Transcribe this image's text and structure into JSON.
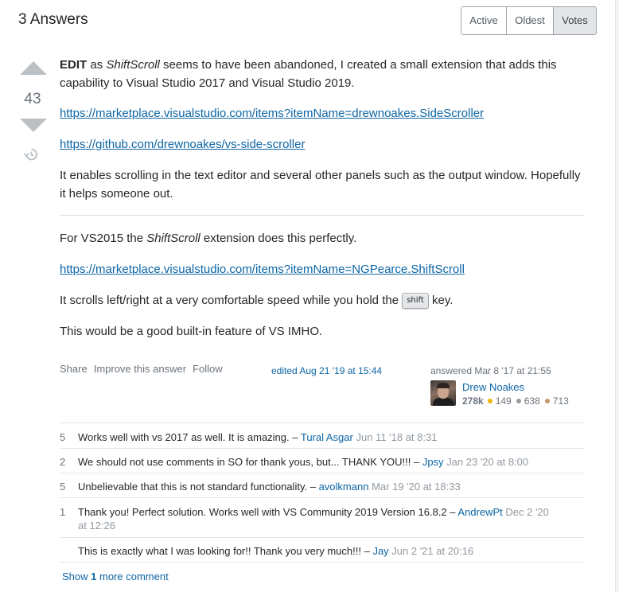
{
  "header": {
    "title": "3 Answers"
  },
  "sort_tabs": [
    {
      "label": "Active",
      "active": false
    },
    {
      "label": "Oldest",
      "active": false
    },
    {
      "label": "Votes",
      "active": true
    }
  ],
  "votes": {
    "count": "43",
    "up_icon": "arrow-up-icon",
    "down_icon": "arrow-down-icon",
    "history_icon": "history-icon"
  },
  "post": {
    "p1_bold": "EDIT",
    "p1_text1": " as ",
    "p1_italic": "ShiftScroll",
    "p1_text2": " seems to have been abandoned, I created a small extension that adds this capability to Visual Studio 2017 and Visual Studio 2019.",
    "link1": "https://marketplace.visualstudio.com/items?itemName=drewnoakes.SideScroller",
    "link2": "https://github.com/drewnoakes/vs-side-scroller",
    "p2": "It enables scrolling in the text editor and several other panels such as the output window. Hopefully it helps someone out.",
    "p3_text1": "For VS2015 the ",
    "p3_italic": "ShiftScroll",
    "p3_text2": " extension does this perfectly.",
    "link3": "https://marketplace.visualstudio.com/items?itemName=NGPearce.ShiftScroll",
    "p4_text1": "It scrolls left/right at a very comfortable speed while you hold the ",
    "p4_kbd": "shift",
    "p4_text2": " key.",
    "p5": "This would be a good built-in feature of VS IMHO."
  },
  "menu": {
    "share": "Share",
    "improve": "Improve this answer",
    "follow": "Follow"
  },
  "edited": "edited Aug 21 '19 at 15:44",
  "answered": "answered Mar 8 '17 at 21:55",
  "user": {
    "name": "Drew Noakes",
    "reputation": "278k",
    "gold": "149",
    "silver": "638",
    "bronze": "713",
    "colors": {
      "gold": "#f1b600",
      "silver": "#9a9a9a",
      "bronze": "#c3956c"
    }
  },
  "comments": [
    {
      "score": "5",
      "text": "Works well with vs 2017 as well. It is amazing.",
      "sep": " – ",
      "user": "Tural Asgar",
      "date": " Jun 11 '18 at 8:31"
    },
    {
      "score": "2",
      "text": "We should not use comments in SO for thank yous, but... THANK YOU!!!",
      "sep": " – ",
      "user": "Jpsy",
      "date": " Jan 23 '20 at 8:00"
    },
    {
      "score": "5",
      "text": "Unbelievable that this is not standard functionality.",
      "sep": " – ",
      "user": "avolkmann",
      "date": " Mar 19 '20 at 18:33"
    },
    {
      "score": "1",
      "text": "Thank you! Perfect solution. Works well with VS Community 2019 Version 16.8.2",
      "sep": " – ",
      "user": "AndrewPt",
      "date": " Dec 2 '20 at 12:26"
    },
    {
      "score": "",
      "text": "This is exactly what I was looking for!! Thank you very much!!!",
      "sep": " – ",
      "user": "Jay",
      "date": " Jun 2 '21 at 20:16"
    }
  ],
  "show_more": {
    "prefix": "Show ",
    "count": "1",
    "suffix": " more comment"
  }
}
